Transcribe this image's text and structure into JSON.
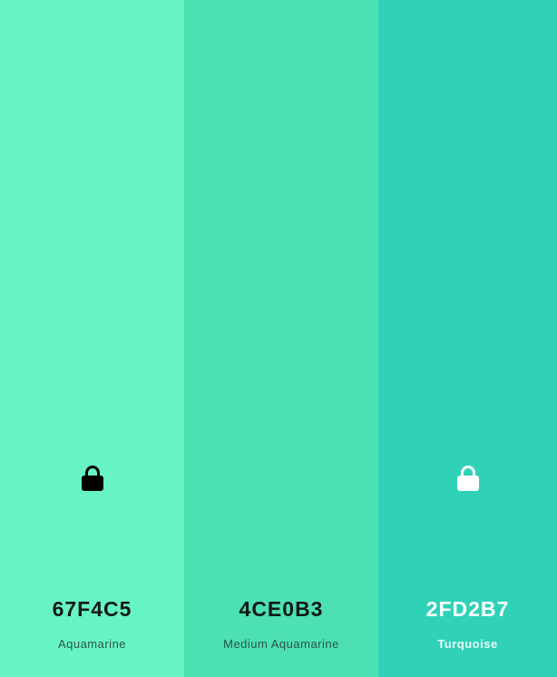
{
  "swatches": [
    {
      "hex": "67F4C5",
      "name": "Aquamarine",
      "color": "#67F4C5",
      "lock_icon": "lock-icon",
      "lock_color": "#000000",
      "lock_visible": true
    },
    {
      "hex": "4CE0B3",
      "name": "Medium Aquamarine",
      "color": "#4CE0B3",
      "lock_icon": "lock-icon",
      "lock_visible": false
    },
    {
      "hex": "2FD2B7",
      "name": "Turquoise",
      "color": "#2FD2B7",
      "lock_icon": "lock-icon",
      "lock_color": "#FFFFFF",
      "lock_visible": true
    }
  ]
}
